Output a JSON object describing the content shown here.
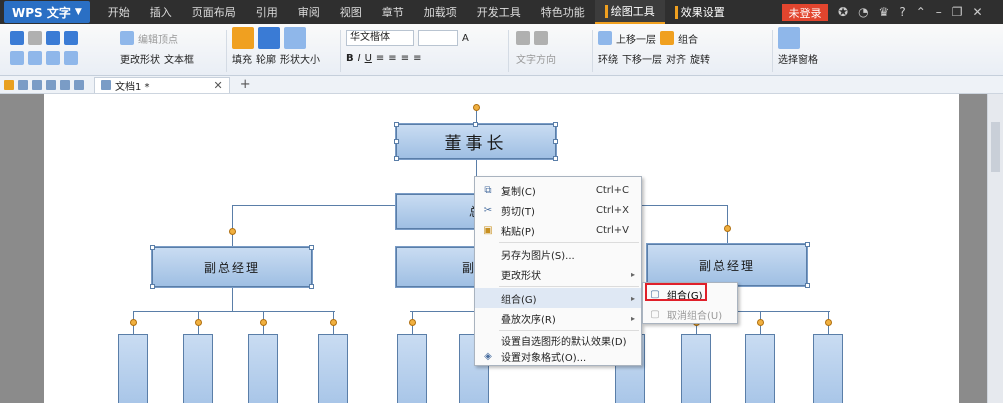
{
  "app": {
    "name": "WPS 文字",
    "login": "未登录"
  },
  "menu": [
    "开始",
    "插入",
    "页面布局",
    "引用",
    "审阅",
    "视图",
    "章节",
    "加载项",
    "开发工具",
    "特色功能"
  ],
  "menu_tool_tabs": [
    "绘图工具",
    "效果设置"
  ],
  "ribbon": {
    "edit_vertex": "编辑顶点",
    "change_shape": "更改形状",
    "textbox": "文本框",
    "fill": "填充",
    "outline": "轮廓",
    "shape_size": "形状大小",
    "font_name": "华文楷体",
    "text_direction": "文字方向",
    "wrap": "环绕",
    "bring_forward": "上移一层",
    "send_backward": "下移一层",
    "align": "对齐",
    "group": "组合",
    "rotate": "旋转",
    "selection_pane": "选择窗格"
  },
  "document": {
    "tab_title": "文档1 *"
  },
  "chart": {
    "chairman": "董事长",
    "gm_partial": "总",
    "vp_left": "副总经理",
    "vp_mid_partial": "副总",
    "vp_right": "副总经理"
  },
  "context_menu": [
    {
      "label": "复制(C)",
      "shortcut": "Ctrl+C",
      "icon": "copy-icon"
    },
    {
      "label": "剪切(T)",
      "shortcut": "Ctrl+X",
      "icon": "scissors-icon"
    },
    {
      "label": "粘贴(P)",
      "shortcut": "Ctrl+V",
      "icon": "paste-icon"
    },
    {
      "label": "另存为图片(S)..."
    },
    {
      "label": "更改形状"
    },
    {
      "label": "组合(G)"
    },
    {
      "label": "叠放次序(R)"
    },
    {
      "label": "设置自选图形的默认效果(D)"
    },
    {
      "label": "设置对象格式(O)...",
      "icon": "format-icon"
    }
  ],
  "submenu": [
    {
      "label": "组合(G)",
      "icon": "group-icon"
    },
    {
      "label": "取消组合(U)",
      "icon": "ungroup-icon"
    }
  ]
}
